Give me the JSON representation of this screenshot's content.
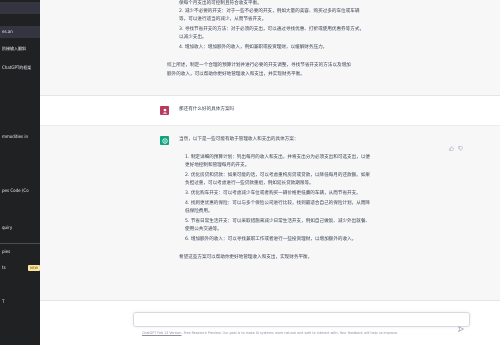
{
  "sidebar": {
    "items": [
      {
        "label": "",
        "active": true
      },
      {
        "label": "es.an",
        "active": true
      },
      {
        "label": "阶梯输入翻斜",
        "active": false
      },
      {
        "label": "ChatGPT的框架",
        "active": false
      },
      {
        "label": "mmodities in",
        "active": false
      },
      {
        "label": "pes Code (Co",
        "active": false
      },
      {
        "label": "quiry",
        "active": false
      },
      {
        "label": "pies",
        "active": false
      },
      {
        "label": "ts",
        "active": false
      }
    ],
    "new_badge": "NEW",
    "bottom_item": "T"
  },
  "previous_answer": {
    "lines": [
      "保每个月支出的可控制且符合收支平衡。",
      "2.  减少不必要的开支：对于一些不必要的开支，例如大量的美容、购买过多的车位或车辆",
      "     等，可以进行适当的减少，从而节省开支。",
      "3.  寻找节省开支的方法：对于必须的支出，可以通过寻找优惠、打折或使用优惠券等方式，",
      "     以减少支出。",
      "4.  增加收入：增加额外的收入，例如兼职或投资理财，以缓解财务压力。",
      "",
      "综上所述，制定一个合理的预算计划并进行必要的开支调整，寻找节省开支的方法以及增加",
      "额外的收入，可以帮助你更好地管理收入和支出，并实现财务平衡。"
    ]
  },
  "question": {
    "text": "那还有什么好的具体方案吗"
  },
  "answer": {
    "intro": "当然，以下是一些可能有助于管理收入和支出的具体方案：",
    "items": [
      "1.  制定详细的预算计划：列出每月的收入和支出，并将支出分为必须支出和可选支出，以便",
      "     更好地控制和管理每月的开支。",
      "2.  优化房贷和贷款：如果可能的话，可以考虑重构房贷或贷款，以降低每月的还款额。如果",
      "     负担过重，可以考虑进行一些贷款重组，例如延长贷款期限等。",
      "3.  优化购车开支：可以考虑减少车位或者购买一辆价格更低廉的车辆，从而节省开支。",
      "4.  找到更优惠的保险：可以与多个保险公司进行比较，找到最适合自己的保险计划，从而降",
      "     低保险费用。",
      "5.  节省日常生活开支：可以采取措施来减少日常生活开支，例如自己做饭、减少外出就餐、",
      "     使用公共交通等。",
      "6.  增加额外的收入：可以寻找兼职工作或者进行一些投资理财，以增加额外的收入。"
    ],
    "outro": "希望这些方案可以帮助你更好地管理收入和支出，实现财务平衡。"
  },
  "input": {
    "placeholder": ""
  },
  "footer": {
    "link": "ChatGPT Feb 13 Version",
    "text": ". Free Research Preview. Our goal is to make AI systems more natural and safe to interact with. Your feedback will help us improve."
  },
  "colors": {
    "sidebar_bg": "#202123",
    "answer_bg": "#f7f7f8",
    "gpt_avatar": "#10a37f",
    "user_avatar": "#b83a5e",
    "new_badge": "#fae69e"
  }
}
